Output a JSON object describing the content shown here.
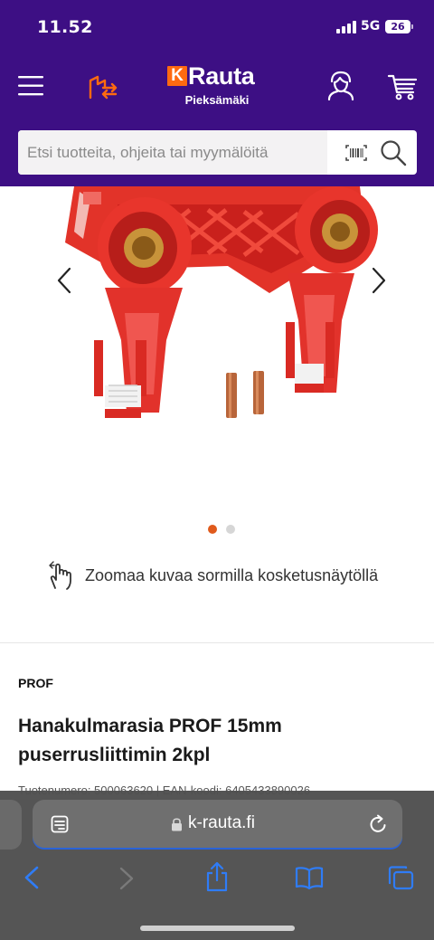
{
  "status_bar": {
    "time": "11.52",
    "network": "5G",
    "battery": "26"
  },
  "header": {
    "logo_k": "K",
    "logo_word": "Rauta",
    "store": "Pieksämäki",
    "icons": [
      "menu-icon",
      "store-switch-icon",
      "account-icon",
      "cart-icon"
    ]
  },
  "search": {
    "placeholder": "Etsi tuotteita, ohjeita tai myymälöitä",
    "icons": [
      "barcode-icon",
      "search-icon"
    ]
  },
  "gallery": {
    "image_index": 1,
    "image_count": 2
  },
  "zoom_hint": "Zoomaa kuvaa sormilla kosketusnäytöllä",
  "product": {
    "brand": "PROF",
    "title": "Hanakulmarasia PROF 15mm puserrusliittimin 2kpl",
    "meta": "Tuotenumero: 500063620 | EAN-koodi: 6405433890026"
  },
  "browser": {
    "url": "k-rauta.fi"
  },
  "colors": {
    "header_bg": "#3d0f84",
    "accent": "#ff6a10",
    "dot_active": "#e05a1c",
    "dot_inactive": "#d6d6d6"
  }
}
